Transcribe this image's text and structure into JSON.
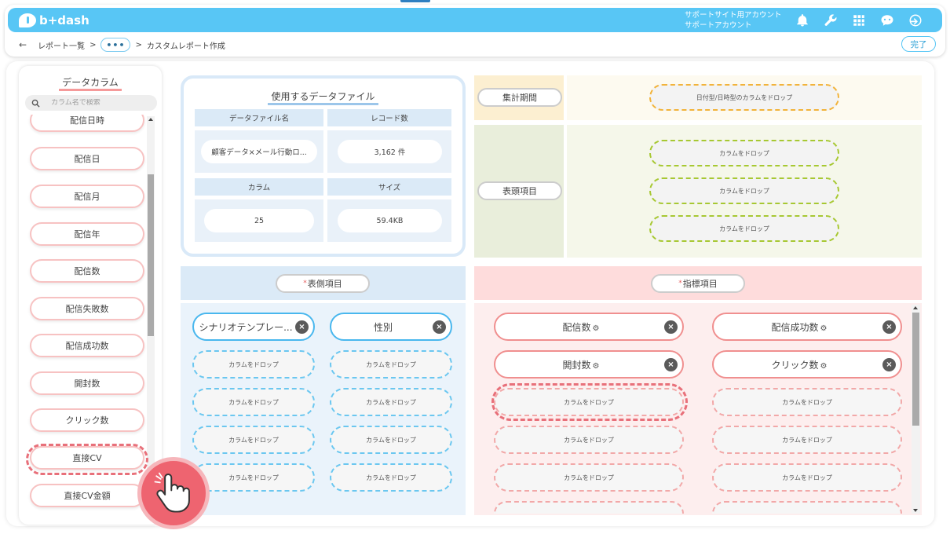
{
  "header": {
    "logo_text": "b+dash",
    "account_line1": "サポートサイト用アカウント",
    "account_line2": "サポートアカウント",
    "icons": [
      "bell-icon",
      "wrench-icon",
      "grid-icon",
      "chat-bot-icon",
      "logout-icon"
    ]
  },
  "breadcrumb": {
    "back": "←",
    "item1": "レポート一覧",
    "sep": ">",
    "more": "•••",
    "current": "カスタムレポート作成"
  },
  "done_label": "完了",
  "sidebar": {
    "title": "データカラム",
    "search_placeholder": "カラム名で検索",
    "columns": [
      "配信日時",
      "配信日",
      "配信月",
      "配信年",
      "配信数",
      "配信失敗数",
      "配信成功数",
      "開封数",
      "クリック数",
      "直接CV",
      "直接CV金額"
    ]
  },
  "file_panel": {
    "title": "使用するデータファイル",
    "h_name": "データファイル名",
    "h_records": "レコード数",
    "v_name": "顧客データ×メール行動ロ...",
    "v_records": "3,162 件",
    "h_columns": "カラム",
    "h_size": "サイズ",
    "v_columns": "25",
    "v_size": "59.4KB"
  },
  "period": {
    "label": "集計期間",
    "drop": "日付型/日時型のカラムをドロップ"
  },
  "header_items": {
    "label": "表頭項目",
    "drop": "カラムをドロップ"
  },
  "row_items": {
    "label": "表側項目",
    "chips": [
      "シナリオテンプレー...",
      "性別"
    ],
    "drop": "カラムをドロップ"
  },
  "indicators": {
    "label": "指標項目",
    "chips": [
      "配信数",
      "配信成功数",
      "開封数",
      "クリック数"
    ],
    "drop": "カラムをドロップ"
  },
  "colors": {
    "brand": "#58c6f5",
    "row_accent": "#49b7ee",
    "indicator_accent": "#f08f8f",
    "drag_highlight": "#e8707a"
  }
}
